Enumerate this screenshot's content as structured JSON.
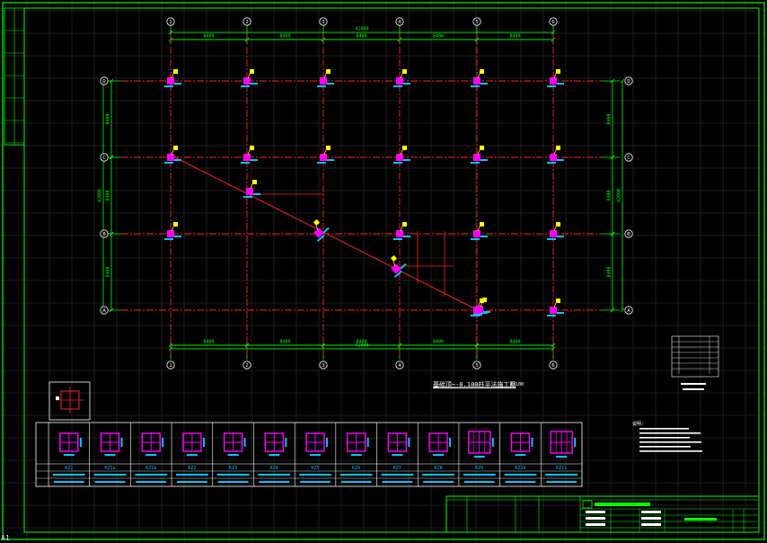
{
  "corner_label": "A1",
  "plan": {
    "title": "基础顶~-0.100柱平法施工图",
    "scale": "1:100"
  },
  "grid": {
    "columns": [
      "1",
      "2",
      "3",
      "4",
      "5",
      "6"
    ],
    "rows": [
      "D",
      "C",
      "B",
      "A"
    ],
    "bay_spacing": "8400",
    "total_length": "42000"
  },
  "notes_header": "说明:",
  "schedule": {
    "section_ids": [
      "KZ1",
      "KZ1a",
      "KZ1b",
      "KZ2",
      "KZ3",
      "KZ4",
      "KZ5",
      "KZ6",
      "KZ7",
      "KZ8",
      "KZ9",
      "KZ10",
      "KZ11"
    ]
  },
  "colors": {
    "border": "#00ff00",
    "grid_axis": "#ff2020",
    "dimension": "#00ff00",
    "column": "#ff00ff",
    "tag": "#ffff00",
    "annotation": "#00c8ff",
    "text": "#ffffff"
  }
}
